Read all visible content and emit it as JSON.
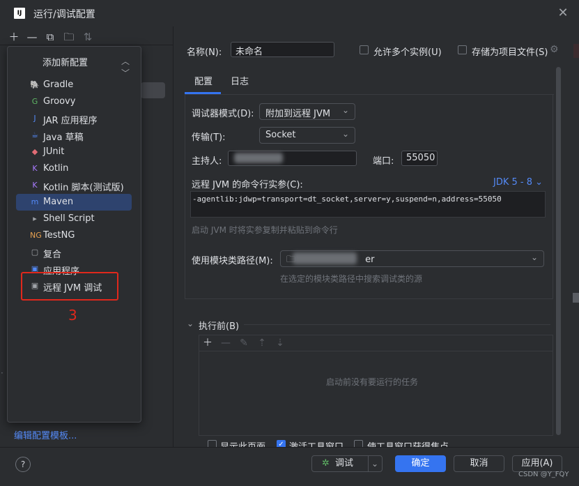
{
  "window": {
    "title": "运行/调试配置",
    "logo_text": "IJ"
  },
  "left_toolbar": [
    "add-icon",
    "remove-icon",
    "copy-icon",
    "folder-add-icon",
    "sort-icon"
  ],
  "add_popup": {
    "title": "添加新配置",
    "items": [
      {
        "label": "Gradle",
        "icon": "gradle-icon",
        "glyph": "🐘",
        "color": "#a0a3a8"
      },
      {
        "label": "Groovy",
        "icon": "groovy-icon",
        "glyph": "G",
        "color": "#5fb865"
      },
      {
        "label": "JAR 应用程序",
        "icon": "jar-icon",
        "glyph": "J",
        "color": "#548af7"
      },
      {
        "label": "Java 草稿",
        "icon": "java-scratch-icon",
        "glyph": "☕",
        "color": "#548af7"
      },
      {
        "label": "JUnit",
        "icon": "junit-icon",
        "glyph": "◆",
        "color": "#e06c75"
      },
      {
        "label": "Kotlin",
        "icon": "kotlin-icon",
        "glyph": "K",
        "color": "#a97bff"
      },
      {
        "label": "Kotlin 脚本(测试版)",
        "icon": "kotlin-script-icon",
        "glyph": "K",
        "color": "#a97bff"
      },
      {
        "label": "Maven",
        "icon": "maven-icon",
        "glyph": "m",
        "color": "#548af7",
        "selected": true
      },
      {
        "label": "Shell Script",
        "icon": "shell-icon",
        "glyph": "▸",
        "color": "#a0a3a8"
      },
      {
        "label": "TestNG",
        "icon": "testng-icon",
        "glyph": "NG",
        "color": "#e5a050"
      },
      {
        "label": "复合",
        "icon": "compound-icon",
        "glyph": "▢",
        "color": "#a0a3a8"
      },
      {
        "label": "应用程序",
        "icon": "application-icon",
        "glyph": "▣",
        "color": "#548af7"
      },
      {
        "label": "远程 JVM 调试",
        "icon": "remote-jvm-icon",
        "glyph": "▣",
        "color": "#a0a3a8"
      }
    ]
  },
  "annotation_number": "3",
  "edit_templates_link": "编辑配置模板...",
  "form": {
    "name_label": "名称(N):",
    "name_value": "未命名",
    "allow_multiple": "允许多个实例(U)",
    "store_as_file": "存储为项目文件(S)",
    "tabs": [
      "配置",
      "日志"
    ],
    "debugger_mode_label": "调试器模式(D):",
    "debugger_mode_value": "附加到远程 JVM",
    "transport_label": "传输(T):",
    "transport_value": "Socket",
    "host_label": "主持人:",
    "port_label": "端口:",
    "port_value": "55050",
    "cmdline_label": "远程 JVM 的命令行实参(C):",
    "jdk_link": "JDK 5 - 8",
    "cmdline_value": "-agentlib:jdwp=transport=dt_socket,server=y,suspend=n,address=55050",
    "cmdline_hint": "启动 JVM 时将实参复制并粘贴到命令行",
    "module_label": "使用模块类路径(M):",
    "module_value": "er",
    "module_hint": "在选定的模块类路径中搜索调试类的源"
  },
  "before_launch": {
    "title": "执行前(B)",
    "empty_text": "启动前没有要运行的任务"
  },
  "bottom_options": [
    "显示此页面",
    "激活工具窗口",
    "使工具窗口获得焦点"
  ],
  "footer": {
    "help": "?",
    "debug_button": "调试",
    "ok_button": "确定",
    "cancel_button": "取消",
    "apply_button": "应用(A)"
  },
  "watermark": "CSDN @Y_FQY",
  "colors": {
    "accent": "#3574f0",
    "link": "#548af7",
    "annotation": "#e0281c",
    "background": "#2b2d30"
  }
}
